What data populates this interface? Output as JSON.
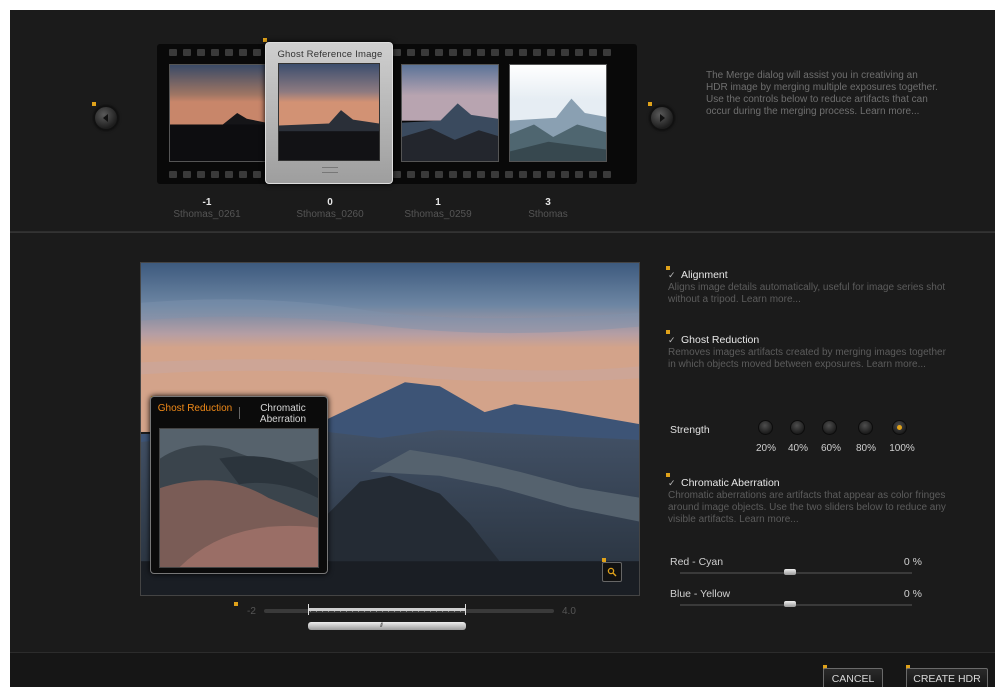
{
  "colors": {
    "accent": "#e0a21a",
    "active_tab": "#f08a18",
    "background": "#1b1b1b"
  },
  "filmstrip": {
    "reference_title": "Ghost Reference Image",
    "thumbnails": [
      {
        "ev": "-1",
        "filename": "Sthomas_0261"
      },
      {
        "ev": "0",
        "filename": "Sthomas_0260"
      },
      {
        "ev": "1",
        "filename": "Sthomas_0259"
      },
      {
        "ev": "3",
        "filename": "Sthomas"
      }
    ]
  },
  "help": {
    "text": "The Merge dialog will assist you in creativing an HDR image by merging multiple exposures together. Use the controls below to reduce artifacts that can occur during the merging process. Learn more..."
  },
  "loupe": {
    "tab_ghost": "Ghost Reduction",
    "tab_chromatic": "Chromatic Aberration"
  },
  "ev_range": {
    "min_label": "-2",
    "max_label": "4.0"
  },
  "options": {
    "alignment": {
      "checked": true,
      "title": "Alignment",
      "desc": "Aligns image details automatically, useful for image series shot without a tripod. Learn more..."
    },
    "ghost": {
      "checked": true,
      "title": "Ghost Reduction",
      "desc": "Removes images artifacts created by merging images together in which objects moved between exposures. Learn more..."
    },
    "chromatic": {
      "checked": true,
      "title": "Chromatic Aberration",
      "desc": "Chromatic aberrations are artifacts that appear as color fringes around image objects. Use the two sliders below to reduce any visible artifacts. Learn more..."
    }
  },
  "strength": {
    "label": "Strength",
    "levels": [
      "20%",
      "40%",
      "60%",
      "80%",
      "100%"
    ],
    "selected": "100%"
  },
  "sliders": {
    "red_cyan": {
      "label": "Red - Cyan",
      "value": "0 %"
    },
    "blue_yellow": {
      "label": "Blue - Yellow",
      "value": "0 %"
    }
  },
  "buttons": {
    "cancel": "CANCEL",
    "create": "CREATE HDR"
  },
  "icons": {
    "prev": "chevron-left-icon",
    "next": "chevron-right-icon",
    "zoom": "magnifier-icon",
    "check": "checkmark-icon"
  }
}
